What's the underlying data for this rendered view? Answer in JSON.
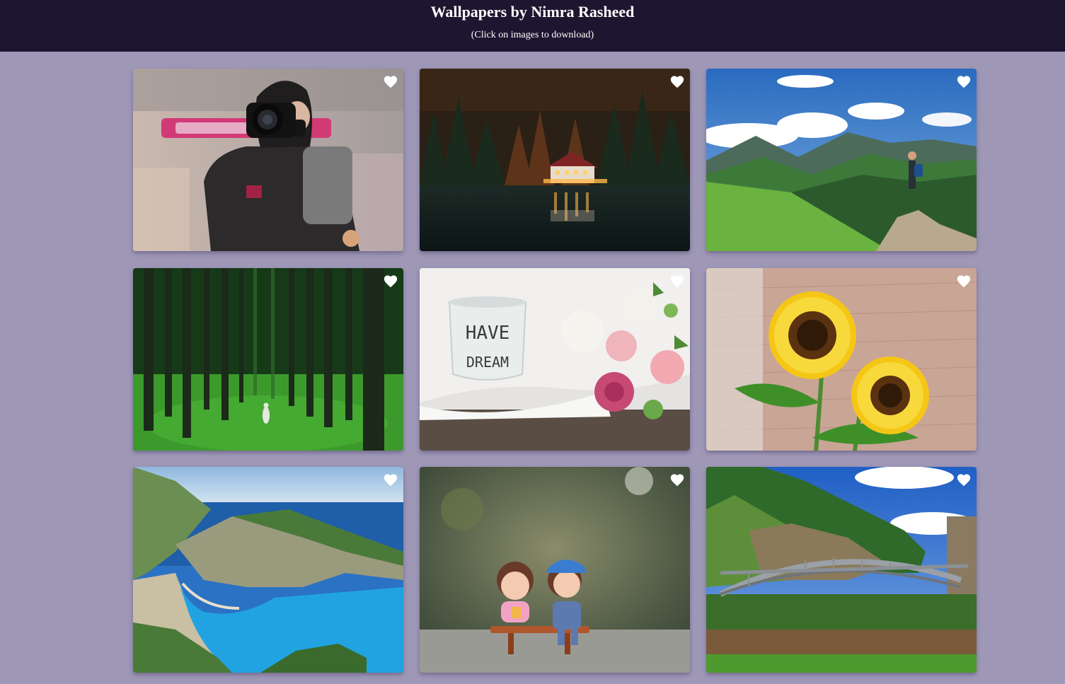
{
  "header": {
    "title": "Wallpapers by Nimra Rasheed",
    "subtitle": "(Click on images to download)"
  },
  "colors": {
    "page_background": "#9e97b6",
    "header_background": "#1e1630",
    "heart": "#ffffff"
  },
  "gallery": {
    "items": [
      {
        "subject": "photographer with camera",
        "favorite_icon": "heart-icon"
      },
      {
        "subject": "lakeside house in autumn forest",
        "favorite_icon": "heart-icon"
      },
      {
        "subject": "hiker on mountain ridge",
        "favorite_icon": "heart-icon"
      },
      {
        "subject": "person in green forest",
        "favorite_icon": "heart-icon"
      },
      {
        "subject": "candle and roses",
        "favorite_icon": "heart-icon",
        "mug_text_1": "HAVE",
        "mug_text_2": "DREAM"
      },
      {
        "subject": "sunflowers by brick wall",
        "favorite_icon": "heart-icon"
      },
      {
        "subject": "coastal bay with blue water",
        "favorite_icon": "heart-icon"
      },
      {
        "subject": "couple figurines on bench",
        "favorite_icon": "heart-icon"
      },
      {
        "subject": "steel arch bridge",
        "favorite_icon": "heart-icon"
      }
    ]
  }
}
